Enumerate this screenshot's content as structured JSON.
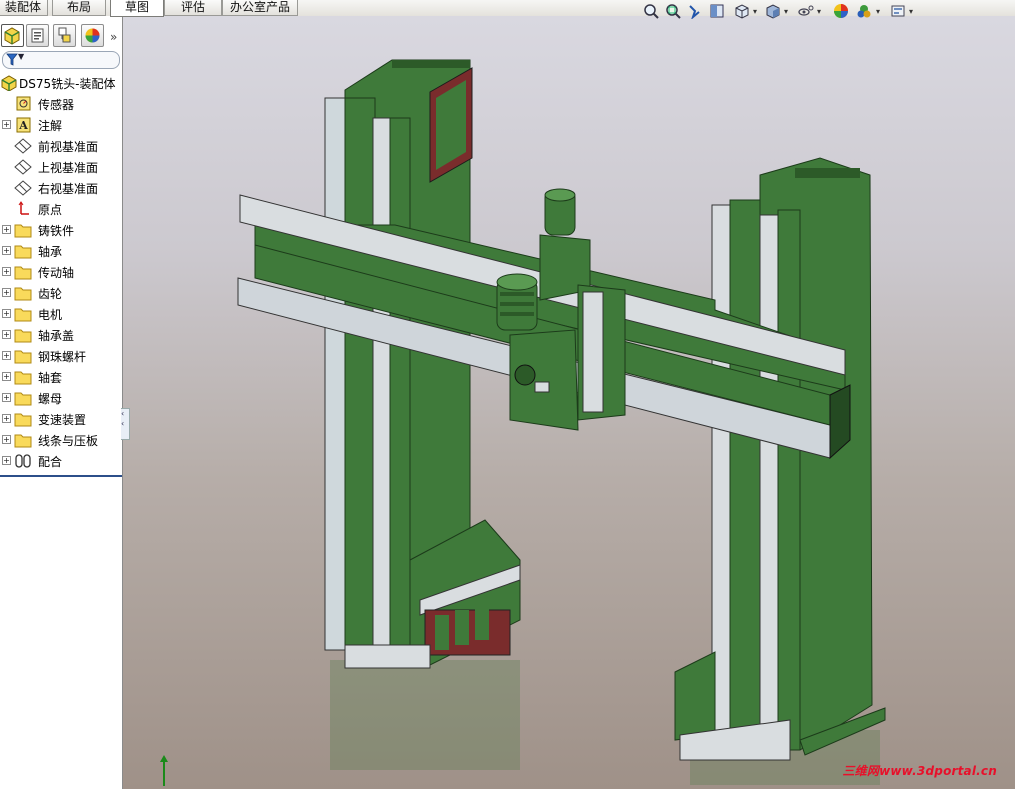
{
  "command_tabs": [
    {
      "label": "装配体",
      "active": false
    },
    {
      "label": "布局",
      "active": false
    },
    {
      "label": "草图",
      "active": true
    },
    {
      "label": "评估",
      "active": false
    },
    {
      "label": "办公室产品",
      "active": false
    }
  ],
  "view_toolbar": {
    "icons": [
      "zoom-to-fit-icon",
      "zoom-to-area-icon",
      "previous-view-icon",
      "section-view-icon",
      "view-orientation-icon",
      "display-style-icon",
      "hide-show-items-icon",
      "edit-appearance-icon",
      "apply-scene-icon",
      "view-settings-icon"
    ]
  },
  "panel": {
    "tabs": [
      "feature-manager-icon",
      "property-manager-icon",
      "configuration-manager-icon",
      "display-manager-icon"
    ],
    "expand_glyph": "»",
    "filter_glyph": "▼",
    "collapse_glyph": "‹"
  },
  "tree": {
    "root": {
      "label": "DS75铣头-装配体",
      "icon": "assembly-icon"
    },
    "items": [
      {
        "label": "传感器",
        "icon": "sensor-icon",
        "expandable": false
      },
      {
        "label": "注解",
        "icon": "annotation-icon",
        "expandable": true
      },
      {
        "label": "前视基准面",
        "icon": "plane-icon",
        "expandable": false
      },
      {
        "label": "上视基准面",
        "icon": "plane-icon",
        "expandable": false
      },
      {
        "label": "右视基准面",
        "icon": "plane-icon",
        "expandable": false
      },
      {
        "label": "原点",
        "icon": "origin-icon",
        "expandable": false
      },
      {
        "label": "铸铁件",
        "icon": "folder-icon",
        "expandable": true
      },
      {
        "label": "轴承",
        "icon": "folder-icon",
        "expandable": true
      },
      {
        "label": "传动轴",
        "icon": "folder-icon",
        "expandable": true
      },
      {
        "label": "齿轮",
        "icon": "folder-icon",
        "expandable": true
      },
      {
        "label": "电机",
        "icon": "folder-icon",
        "expandable": true
      },
      {
        "label": "轴承盖",
        "icon": "folder-icon",
        "expandable": true
      },
      {
        "label": "钢珠螺杆",
        "icon": "folder-icon",
        "expandable": true
      },
      {
        "label": "轴套",
        "icon": "folder-icon",
        "expandable": true
      },
      {
        "label": "螺母",
        "icon": "folder-icon",
        "expandable": true
      },
      {
        "label": "变速装置",
        "icon": "folder-icon",
        "expandable": true
      },
      {
        "label": "线条与压板",
        "icon": "folder-icon",
        "expandable": true
      },
      {
        "label": "配合",
        "icon": "mates-icon",
        "expandable": true
      }
    ]
  },
  "viewport": {
    "watermark": "三维网www.3dportal.cn",
    "model_colors": {
      "body": "#3f7a3a",
      "body_dark": "#244a22",
      "machined": "#d9dde0",
      "rail": "#c7cbd0",
      "accent": "#7a2c2c"
    }
  }
}
